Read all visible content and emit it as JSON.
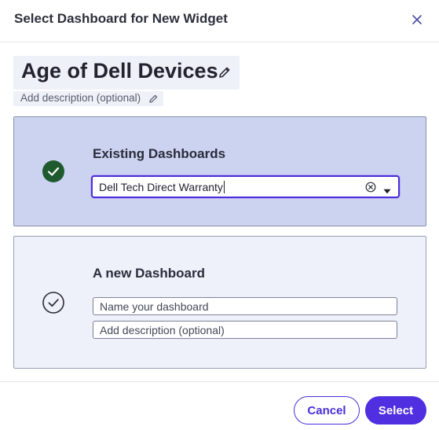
{
  "dialog": {
    "title": "Select Dashboard for New Widget",
    "close_icon": "close-icon"
  },
  "widget": {
    "name": "Age of Dell Devices",
    "name_edit_icon": "pencil-icon",
    "description_placeholder": "Add description (optional)",
    "description_edit_icon": "pencil-icon"
  },
  "options": {
    "existing": {
      "title": "Existing Dashboards",
      "selected": true,
      "radio_icon": "check-circle-filled-icon",
      "dropdown_value": "Dell Tech Direct Warranty",
      "clear_icon": "clear-circle-icon",
      "dropdown_icon": "caret-down-icon"
    },
    "new": {
      "title": "A new Dashboard",
      "selected": false,
      "radio_icon": "check-circle-outline-icon",
      "name_placeholder": "Name your dashboard",
      "description_placeholder": "Add description (optional)"
    }
  },
  "footer": {
    "cancel_label": "Cancel",
    "select_label": "Select"
  },
  "colors": {
    "accent": "#4f2fe0",
    "selected_card_bg": "#cbd3f0",
    "unselected_card_bg": "#eef1f9",
    "check_green": "#1f5a2e"
  }
}
